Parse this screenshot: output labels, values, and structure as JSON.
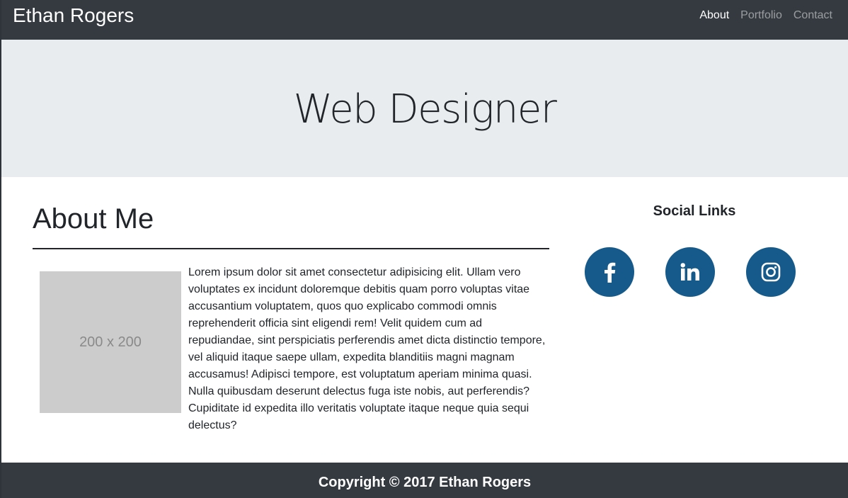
{
  "navbar": {
    "brand": "Ethan Rogers",
    "links": [
      {
        "label": "About",
        "active": true
      },
      {
        "label": "Portfolio",
        "active": false
      },
      {
        "label": "Contact",
        "active": false
      }
    ]
  },
  "jumbotron": {
    "title": "Web Designer"
  },
  "about": {
    "heading": "About Me",
    "image_placeholder": "200 x 200",
    "text": "Lorem ipsum dolor sit amet consectetur adipisicing elit. Ullam vero voluptates ex incidunt doloremque debitis quam porro voluptas vitae accusantium voluptatem, quos quo explicabo commodi omnis reprehenderit officia sint eligendi rem! Velit quidem cum ad repudiandae, sint perspiciatis perferendis amet dicta distinctio tempore, vel aliquid itaque saepe ullam, expedita blanditiis magni magnam accusamus! Adipisci tempore, est voluptatum aperiam minima quasi. Nulla quibusdam deserunt delectus fuga iste nobis, aut perferendis? Cupiditate id expedita illo veritatis voluptate itaque neque quia sequi delectus?"
  },
  "social": {
    "title": "Social Links",
    "links": [
      {
        "icon": "facebook-icon"
      },
      {
        "icon": "linkedin-icon"
      },
      {
        "icon": "instagram-icon"
      }
    ],
    "accent_color": "#155a8a"
  },
  "footer": {
    "text": "Copyright © 2017 Ethan Rogers"
  },
  "colors": {
    "navbar_bg": "#343a40",
    "jumbotron_bg": "#e9ecef"
  }
}
